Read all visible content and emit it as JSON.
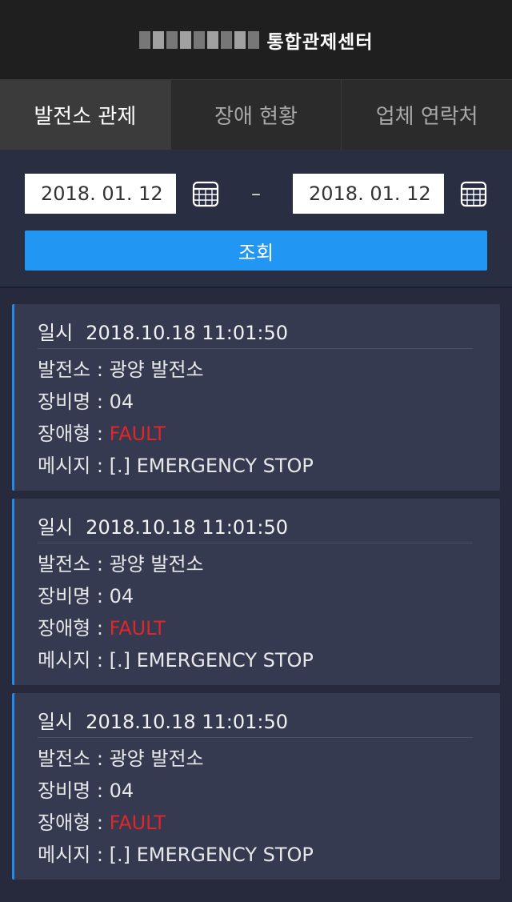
{
  "header": {
    "title": "통합관제센터"
  },
  "tabs": [
    {
      "label": "발전소 관제"
    },
    {
      "label": "장애 현황"
    },
    {
      "label": "업체 연락처"
    }
  ],
  "search": {
    "start_date": "2018. 01. 12",
    "end_date": "2018. 01. 12",
    "separator": "–",
    "button_label": "조회"
  },
  "cards": [
    {
      "time_label": "일시",
      "time": "2018.10.18 11:01:50",
      "plant_label": "발전소 : ",
      "plant": "광양 발전소",
      "device_label": "장비명 : ",
      "device": "04",
      "type_label": "장애형 : ",
      "type": "FAULT",
      "message_label": "메시지 : ",
      "message": "[.] EMERGENCY STOP"
    },
    {
      "time_label": "일시",
      "time": "2018.10.18 11:01:50",
      "plant_label": "발전소 : ",
      "plant": "광양 발전소",
      "device_label": "장비명 : ",
      "device": "04",
      "type_label": "장애형 : ",
      "type": "FAULT",
      "message_label": "메시지 : ",
      "message": "[.] EMERGENCY STOP"
    },
    {
      "time_label": "일시",
      "time": "2018.10.18 11:01:50",
      "plant_label": "발전소 : ",
      "plant": "광양 발전소",
      "device_label": "장비명 : ",
      "device": "04",
      "type_label": "장애형 : ",
      "type": "FAULT",
      "message_label": "메시지 : ",
      "message": "[.] EMERGENCY STOP"
    }
  ],
  "colors": {
    "accent": "#2197f3",
    "fault": "#e0262a",
    "card_border": "#2589e8"
  },
  "icons": {
    "calendar": "calendar-icon"
  }
}
